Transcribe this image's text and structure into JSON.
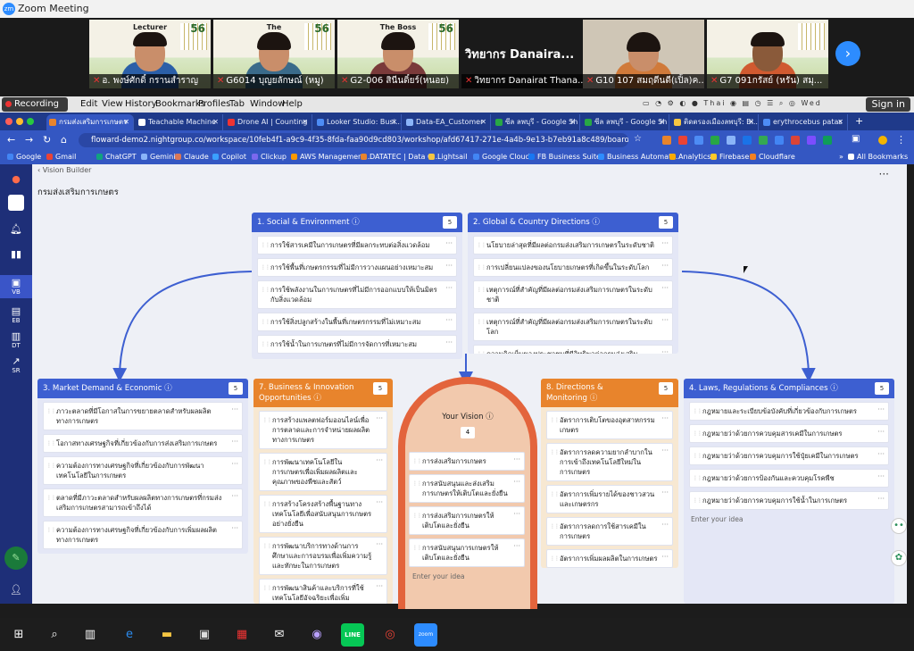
{
  "zoom": {
    "title": "Zoom Meeting",
    "participants": [
      {
        "name": "อ. พงษ์ศักดิ์ กรานสำราญ",
        "top": "Lecturer",
        "shirt": "#2b5fa8"
      },
      {
        "name": "G6014 บุญยลักษณ์ (หมู)",
        "top": "The",
        "shirt": "#3a6b8a"
      },
      {
        "name": "G2-006 สินีนดิ์ยร์(หนอย)",
        "top": "The Boss",
        "shirt": "#7a3a3a"
      },
      {
        "name": "วิทยากร Danairat Thana...",
        "top": "วิทยากร Danaira...",
        "shirt": "#222"
      },
      {
        "name": "G10 107 สมฤดีนดี(เปิ้ล)ค...",
        "top": "",
        "shirt": "#d07a3a"
      },
      {
        "name": "G7 091กรัสย์ (หรัน) สมุ...",
        "top": "",
        "shirt": "#d05a30"
      }
    ],
    "page_digits": "56"
  },
  "mac": {
    "recording": "Recording",
    "menus": [
      "Edit",
      "View",
      "History",
      "Bookmarks",
      "Profiles",
      "Tab",
      "Window",
      "Help"
    ],
    "tray": "Thai",
    "clock": "Wed",
    "signin": "Sign in"
  },
  "browser": {
    "tabs": [
      "กรมส่งเสริมการเกษตร",
      "Teachable Machine",
      "Drone AI | Counting",
      "Looker Studio: Busi...",
      "Data-EA_Customer",
      "ซีล ลพบุรี - Google Sh",
      "ซีล ลพบุรี - Google Sh",
      "ติดตรองเมืองลพบุรี: Bi...",
      "erythrocebus patas"
    ],
    "url": "floward-demo2.nightgroup.co/workspace/10feb4f1-a9c9-4f35-8fda-faa90d9cd803/workshop/afd67417-271e-4a4b-9e13-b7eb91a8c489/board/b9cbf79c-eb...",
    "bookmarks": [
      "Google",
      "Gmail",
      "ChatGPT",
      "Gemini",
      "Claude",
      "Copilot",
      "Clickup",
      "AWS Management...",
      "DATATEC | Data G...",
      "Lightsail",
      "Google Cloud",
      "FB Business Suite",
      "Business Automati...",
      "Analytics",
      "Firebase",
      "Cloudflare"
    ],
    "all_bookmarks": "All Bookmarks"
  },
  "app": {
    "breadcrumb": "Vision Builder",
    "title": "กรมส่งเสริมการเกษตร",
    "rail": [
      "VB",
      "EB",
      "DT",
      "SR"
    ],
    "enter_idea": "Enter your idea",
    "cards": [
      {
        "title": "1. Social & Environment ⓘ",
        "count": "5",
        "color": "#3d5fd1",
        "items": [
          "การใช้สารเคมีในการเกษตรที่มีผลกระทบต่อสิ่งแวดล้อม",
          "การใช้พื้นที่เกษตรกรรมที่ไม่มีการวางแผนอย่างเหมาะสม",
          "การใช้พลังงานในการเกษตรที่ไม่มีการออกแบบให้เป็นมิตรกับสิ่งแวดล้อม",
          "การใช้สิ่งปลูกสร้างในพื้นที่เกษตรกรรมที่ไม่เหมาะสม",
          "การใช้น้ำในการเกษตรที่ไม่มีการจัดการที่เหมาะสม"
        ]
      },
      {
        "title": "2. Global & Country Directions ⓘ",
        "count": "5",
        "color": "#3d5fd1",
        "items": [
          "นโยบายล่าสุดที่มีผลต่อกรมส่งเสริมการเกษตรในระดับชาติ",
          "การเปลี่ยนแปลงของนโยบายเกษตรที่เกิดขึ้นในระดับโลก",
          "เหตุการณ์ที่สำคัญที่มีผลต่อกรมส่งเสริมการเกษตรในระดับชาติ",
          "เหตุการณ์ที่สำคัญที่มีผลต่อกรมส่งเสริมการเกษตรในระดับโลก",
          "ความคิดเห็นของประชาชนที่มีอิทธิพลต่อกรมส่งเสริมการเกษตร"
        ]
      },
      {
        "title": "3. Market Demand & Economic ⓘ",
        "count": "5",
        "color": "#3d5fd1",
        "items": [
          "ภาวะตลาดที่มีโอกาสในการขยายตลาดสำหรับผลผลิตทางการเกษตร",
          "โอกาสทางเศรษฐกิจที่เกี่ยวข้องกับการส่งเสริมการเกษตร",
          "ความต้องการทางเศรษฐกิจที่เกี่ยวข้องกับการพัฒนาเทคโนโลยีในการเกษตร",
          "ตลาดที่มีภาวะตลาดสำหรับผลผลิตทางการเกษตรที่กรมส่งเสริมการเกษตรสามารถเข้าถึงได้",
          "ความต้องการทางเศรษฐกิจที่เกี่ยวข้องกับการเพิ่มผลผลิตทางการเกษตร"
        ]
      },
      {
        "title": "7. Business & Innovation Opportunities",
        "count": "5",
        "color": "#e8842c",
        "items": [
          "การสร้างแพลตฟอร์มออนไลน์เพื่อการตลาดและการจำหน่ายผลผลิตทางการเกษตร",
          "การพัฒนาเทคโนโลยีในการเกษตรเพื่อเพิ่มผลผลิตและคุณภาพของพืชและสัตว์",
          "การสร้างโครงสร้างพื้นฐานทางเทคโนโลยีเพื่อสนับสนุนการเกษตรอย่างยั่งยืน",
          "การพัฒนาบริการทางด้านการศึกษาและการอบรมเพื่อเพิ่มความรู้และทักษะในการเกษตร",
          "การพัฒนาสินค้าและบริการที่ใช้เทคโนโลยีอัจฉริยะเพื่อเพิ่มประสิทธิภาพในการเกษตร"
        ]
      },
      {
        "title": "8. Directions & Monitoring",
        "count": "5",
        "color": "#e8842c",
        "items": [
          "อัตราการเติบโตของอุตสาหกรรมเกษตร",
          "อัตราการลดความยากลำบากในการเข้าถึงเทคโนโลยีใหม่ในการเกษตร",
          "อัตราการเพิ่มรายได้ของชาวสวนและเกษตรกร",
          "อัตราการลดการใช้สารเคมีในการเกษตร",
          "อัตราการเพิ่มผลผลิตในการเกษตร"
        ]
      },
      {
        "title": "4. Laws, Regulations & Compliances ⓘ",
        "count": "5",
        "color": "#3d5fd1",
        "items": [
          "กฎหมายและระเบียบข้อบังคับที่เกี่ยวข้องกับการเกษตร",
          "กฎหมายว่าด้วยการควบคุมสารเคมีในการเกษตร",
          "กฎหมายว่าด้วยการควบคุมการใช้ปุ๋ยเคมีในการเกษตร",
          "กฎหมายว่าด้วยการป้องกันและควบคุมโรคพืช",
          "กฎหมายว่าด้วยการควบคุมการใช้น้ำในการเกษตร"
        ]
      }
    ],
    "vision": {
      "title": "Your Vision ⓘ",
      "count": "4",
      "items": [
        "การส่งเสริมการเกษตร",
        "การสนับสนุนและส่งเสริมการเกษตรให้เติบโตและยั่งยืน",
        "การส่งเสริมการเกษตรให้เติบโตและยั่งยืน",
        "การสนับสนุนการเกษตรให้เติบโตและยั่งยืน"
      ]
    }
  }
}
